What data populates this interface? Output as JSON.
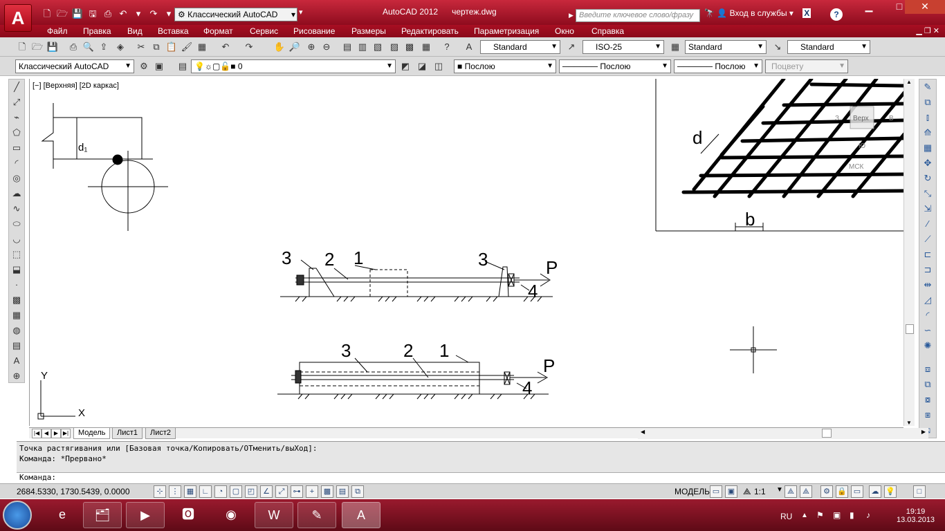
{
  "app": {
    "title": "AutoCAD 2012",
    "filename": "чертеж.dwg",
    "logo": "A",
    "workspace": "Классический AutoCAD",
    "search_placeholder": "Введите ключевое слово/фразу",
    "signin": "Вход в службы",
    "help": "?"
  },
  "menu": [
    "Файл",
    "Правка",
    "Вид",
    "Вставка",
    "Формат",
    "Сервис",
    "Рисование",
    "Размеры",
    "Редактировать",
    "Параметризация",
    "Окно",
    "Справка"
  ],
  "toolbar1": {
    "text_style": "Standard",
    "dim_style": "ISO-25",
    "table_style": "Standard",
    "mleader_style": "Standard"
  },
  "toolbar2": {
    "workspace": "Классический AutoCAD",
    "layer": "0",
    "color": "Послою",
    "linetype": "Послою",
    "lineweight": "Послою",
    "plotstyle": "Поцвету"
  },
  "viewport": {
    "label": "[−] [Верхняя] [2D каркас]"
  },
  "drawing": {
    "d1_label": "d₁",
    "d_label": "d",
    "b_label": "b",
    "viewcube_top": "Верх",
    "viewcube_s": "З",
    "viewcube_v": "В",
    "viewcube_yu": "Ю",
    "mck": "МСК",
    "top_view": {
      "labels": [
        "3",
        "2",
        "1",
        "3",
        "4",
        "P"
      ]
    },
    "bottom_view": {
      "labels": [
        "3",
        "2",
        "1",
        "4",
        "P"
      ]
    },
    "ucs_x": "X",
    "ucs_y": "Y"
  },
  "tabs": [
    "Модель",
    "Лист1",
    "Лист2"
  ],
  "commands": {
    "line1": "Точка растягивания или [Базовая точка/Копировать/ОТменить/выХод]:",
    "line2": "Команда: *Прервано*",
    "prompt": "Команда:"
  },
  "status": {
    "coords": "2684.5330, 1730.5439, 0.0000",
    "model": "МОДЕЛЬ",
    "scale": "1:1"
  },
  "taskbar": {
    "lang": "RU",
    "time": "19:19",
    "date": "13.03.2013"
  },
  "colors": {
    "titlebar": "#b0102a",
    "toolbar": "#dcdcdc",
    "taskbar": "#7a1020"
  }
}
